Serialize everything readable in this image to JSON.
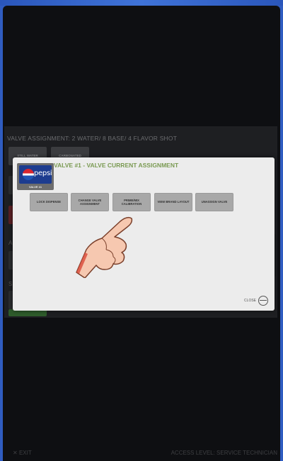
{
  "background": {
    "title": "VALVE ASSIGNMENT: 2 WATER/ 8 BASE/ 4 FLAVOR SHOT",
    "buttons": [
      "STILL WATER",
      "CARBONATED"
    ],
    "side_letters": [
      "A",
      "S"
    ]
  },
  "modal": {
    "logo_text": "pepsi",
    "logo_sub": "VALVE #1",
    "title": "VALVE #1 - VALVE CURRENT ASSIGNMENT",
    "buttons": [
      "LOCK DISPENSE",
      "CHANGE VALVE ASSIGNMENT",
      "PRIME/MIX CALIBRATION",
      "VIEW BRAND LAYOUT",
      "UNASSIGN VALVE"
    ],
    "close_label": "CLOSE"
  },
  "footer": {
    "exit_label": "EXIT",
    "access_level": "ACCESS LEVEL: SERVICE TECHNICIAN"
  },
  "colors": {
    "accent": "#7a9a52",
    "modal_bg": "#ececec",
    "button": "#a8a8a8"
  }
}
